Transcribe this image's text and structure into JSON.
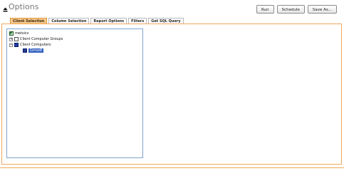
{
  "header": {
    "title": "Options",
    "collapse_icon": "collapse-arrow-icon",
    "buttons": {
      "run": "Run",
      "schedule": "Schedule",
      "save_as": "Save As..."
    }
  },
  "tabs": [
    {
      "label": "Client Selection",
      "active": true
    },
    {
      "label": "Column Selection",
      "active": false
    },
    {
      "label": "Report Options",
      "active": false
    },
    {
      "label": "Filters",
      "active": false
    },
    {
      "label": "Get SQL Query",
      "active": false
    }
  ],
  "tree": {
    "root": {
      "label": "metsics",
      "icon": "database-icon"
    },
    "groups": {
      "label": "Client Computer Groups",
      "expander": "+",
      "icon": "folder-icon"
    },
    "computers": {
      "label": "Client Computers",
      "expander": "−",
      "icon": "folder-icon"
    },
    "selected": {
      "label": "Grroo8",
      "icon": "computer-icon"
    }
  },
  "colors": {
    "accent": "#f0a85a",
    "active_tab": "#f7c88a",
    "selection": "#2f5fbf",
    "tree_border": "#7ea4cf"
  }
}
